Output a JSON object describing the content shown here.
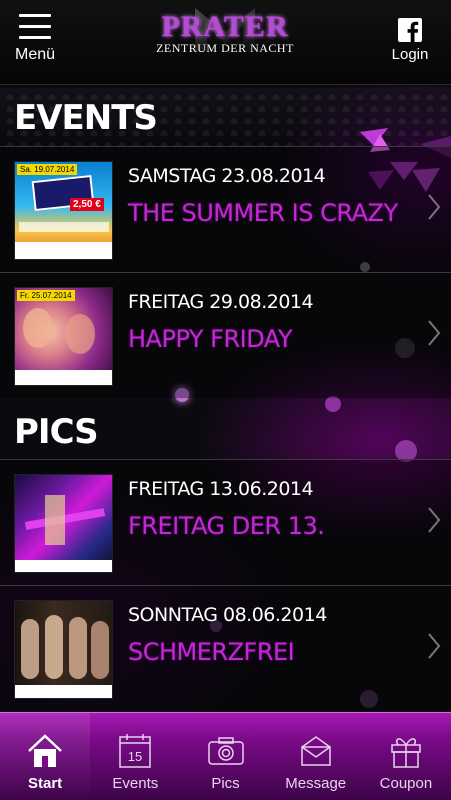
{
  "header": {
    "menu_label": "Menü",
    "logo_title": "PRATER",
    "logo_subtitle": "ZENTRUM DER NACHT",
    "login_label": "Login"
  },
  "events": {
    "title": "EVENTS",
    "items": [
      {
        "date": "SAMSTAG 23.08.2014",
        "title": "THE SUMMER IS CRAZY",
        "thumb_tag": "Sa. 19.07.2014",
        "thumb_badge": "2,50 €"
      },
      {
        "date": "FREITAG 29.08.2014",
        "title": "HAPPY FRIDAY",
        "thumb_tag": "Fr. 25.07.2014"
      }
    ]
  },
  "pics": {
    "title": "PICS",
    "items": [
      {
        "date": "FREITAG 13.06.2014",
        "title": "FREITAG DER 13."
      },
      {
        "date": "SONNTAG 08.06.2014",
        "title": "SCHMERZFREI"
      }
    ]
  },
  "nav": {
    "items": [
      {
        "label": "Start",
        "icon": "home-icon",
        "active": true
      },
      {
        "label": "Events",
        "icon": "calendar-icon",
        "calendar_day": "15"
      },
      {
        "label": "Pics",
        "icon": "camera-icon"
      },
      {
        "label": "Message",
        "icon": "envelope-icon"
      },
      {
        "label": "Coupon",
        "icon": "gift-icon"
      }
    ]
  },
  "colors": {
    "accent": "#c02ad2",
    "nav_bg": "#8a0f98",
    "header_bg": "#0a0a0a"
  }
}
